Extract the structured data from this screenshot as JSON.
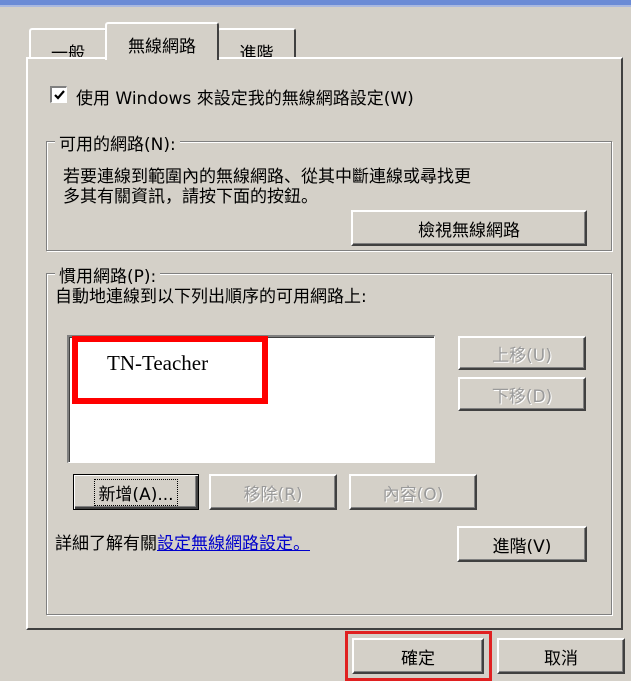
{
  "tabs": [
    {
      "label": "一般"
    },
    {
      "label": "無線網路"
    },
    {
      "label": "進階"
    }
  ],
  "use_windows_checkbox": {
    "label": "使用 Windows 來設定我的無線網路設定(W)",
    "checked": true
  },
  "available_networks": {
    "legend": "可用的網路(N):",
    "description_line1": "若要連線到範圍內的無線網路、從其中斷連線或尋找更",
    "description_line2": "多其有關資訊，請按下面的按鈕。",
    "view_button": "檢視無線網路"
  },
  "preferred_networks": {
    "legend": "慣用網路(P):",
    "description": "自動地連線到以下列出順序的可用網路上:",
    "list_items": [
      "TN-Teacher"
    ],
    "move_up_button": "上移(U)",
    "move_down_button": "下移(D)",
    "add_button": "新增(A)...",
    "remove_button": "移除(R)",
    "properties_button": "內容(O)"
  },
  "learn_more": {
    "prefix": "詳細了解有關",
    "link": "設定無線網路設定。"
  },
  "advanced_button": "進階(V)",
  "dialog_buttons": {
    "ok": "確定",
    "cancel": "取消"
  },
  "colors": {
    "highlight_red": "#ff0000",
    "link_blue": "#0000cc",
    "dialog_gray": "#d4d0c8"
  }
}
